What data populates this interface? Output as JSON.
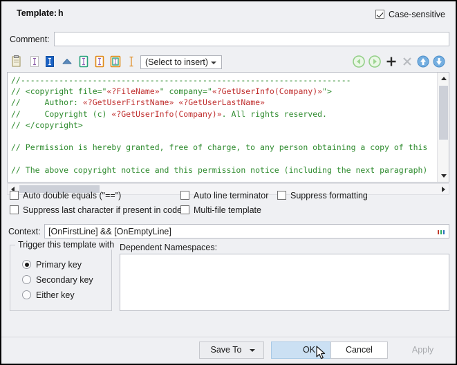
{
  "dialog": {
    "template_label": "Template:",
    "template_value": "h",
    "case_sensitive_label": "Case-sensitive",
    "case_sensitive_checked": true,
    "comment_label": "Comment:",
    "comment_value": "",
    "comment_placeholder": ""
  },
  "toolbar": {
    "insert_combo_value": "(Select to insert)",
    "icons": [
      {
        "name": "clipboard-icon",
        "title": "Insert clipboard"
      },
      {
        "name": "variable-field-icon",
        "title": "Variable field"
      },
      {
        "name": "selected-field-icon",
        "title": "Selected field"
      },
      {
        "name": "collapse-icon",
        "title": "Collapse"
      },
      {
        "name": "green-field-icon",
        "title": "Editable field"
      },
      {
        "name": "orange-field-icon",
        "title": "Macro field"
      },
      {
        "name": "orange-green-field-icon",
        "title": "Mixed field"
      },
      {
        "name": "caret-field-icon",
        "title": "End caret"
      }
    ],
    "right_icons": [
      {
        "name": "previous-field-icon"
      },
      {
        "name": "next-field-icon"
      },
      {
        "name": "add-icon"
      },
      {
        "name": "delete-icon"
      },
      {
        "name": "move-up-icon"
      },
      {
        "name": "move-down-icon"
      }
    ]
  },
  "editor": {
    "lines": [
      {
        "segments": [
          {
            "t": "//---------------------------------------------------------------------",
            "k": "c"
          }
        ]
      },
      {
        "segments": [
          {
            "t": "// <copyright file=\"",
            "k": "c"
          },
          {
            "t": "«?FileName»",
            "k": "m"
          },
          {
            "t": "\" company=\"",
            "k": "c"
          },
          {
            "t": "«?GetUserInfo(Company)»",
            "k": "m"
          },
          {
            "t": "\">",
            "k": "c"
          }
        ]
      },
      {
        "segments": [
          {
            "t": "//     Author: ",
            "k": "c"
          },
          {
            "t": "«?GetUserFirstName»",
            "k": "m"
          },
          {
            "t": " ",
            "k": "c"
          },
          {
            "t": "«?GetUserLastName»",
            "k": "m"
          }
        ]
      },
      {
        "segments": [
          {
            "t": "//     Copyright (c) ",
            "k": "c"
          },
          {
            "t": "«?GetUserInfo(Company)»",
            "k": "m"
          },
          {
            "t": ". All rights reserved.",
            "k": "c"
          }
        ]
      },
      {
        "segments": [
          {
            "t": "// </copyright>",
            "k": "c"
          }
        ]
      },
      {
        "segments": []
      },
      {
        "segments": [
          {
            "t": "// Permission is hereby granted, free of charge, to any person obtaining a copy of this",
            "k": "c"
          }
        ]
      },
      {
        "segments": []
      },
      {
        "segments": [
          {
            "t": "// The above copyright notice and this permission notice (including the next paragraph)",
            "k": "c"
          }
        ]
      }
    ],
    "comment_color": "#2e8b2e",
    "macro_color": "#c03030"
  },
  "options": [
    {
      "name": "auto-double-equals",
      "label": "Auto double equals (\"==\")",
      "checked": false
    },
    {
      "name": "auto-line-terminator",
      "label": "Auto line terminator",
      "checked": false
    },
    {
      "name": "suppress-formatting",
      "label": "Suppress formatting",
      "checked": false
    },
    {
      "name": "suppress-last-character",
      "label": "Suppress last character if present in code",
      "checked": false
    },
    {
      "name": "multi-file-template",
      "label": "Multi-file template",
      "checked": false
    }
  ],
  "context": {
    "label": "Context:",
    "value": "[OnFirstLine] && [OnEmptyLine]",
    "ellipsis_label": "..."
  },
  "trigger_group": {
    "title": "Trigger this template with",
    "options": [
      {
        "name": "primary-key",
        "label": "Primary key",
        "selected": true
      },
      {
        "name": "secondary-key",
        "label": "Secondary key",
        "selected": false
      },
      {
        "name": "either-key",
        "label": "Either key",
        "selected": false
      }
    ]
  },
  "dependent_namespaces": {
    "label": "Dependent Namespaces:",
    "value": ""
  },
  "footer": {
    "save_to_label": "Save To",
    "ok_label": "OK",
    "cancel_label": "Cancel",
    "apply_label": "Apply",
    "apply_enabled": false,
    "ok_hover_color": "#cbe0f3"
  }
}
